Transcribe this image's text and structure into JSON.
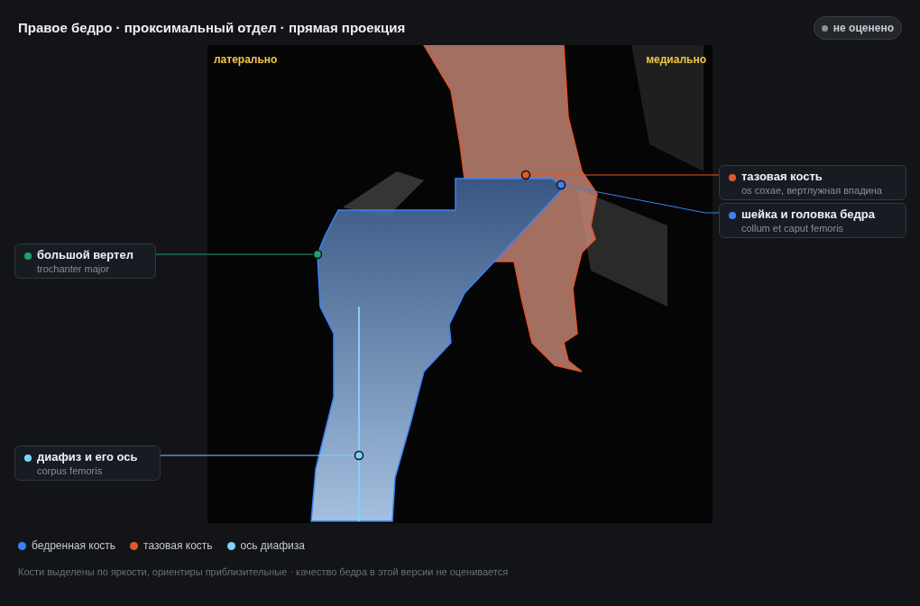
{
  "title": "Правое бедро · проксимальный отдел · прямая проекция",
  "status_badge": {
    "label": "не оценено",
    "kind": "not_rated"
  },
  "image": {
    "left_label": "латерально",
    "right_label": "медиально"
  },
  "landmarks": [
    {
      "kind": "pelvis",
      "name": "тазовая кость",
      "latin": "os coxae, вертлужная впадина",
      "color": "#e2572b"
    },
    {
      "kind": "femoral_head",
      "name": "шейка и головка бедра",
      "latin": "collum et caput femoris",
      "color": "#3b82f6"
    },
    {
      "kind": "trochanter",
      "name": "большой вертел",
      "latin": "trochanter major",
      "color": "#1fa36b"
    },
    {
      "kind": "shaft",
      "name": "диафиз и его ось",
      "latin": "corpus femoris",
      "color": "#7dd3fc"
    }
  ],
  "legend": [
    {
      "label": "бедренная кость",
      "color": "#3b82f6"
    },
    {
      "label": "тазовая кость",
      "color": "#e2572b"
    },
    {
      "label": "ось диафиза",
      "color": "#7dd3fc"
    }
  ],
  "footnote": "Кости выделены по яркости, ориентиры приблизительные · качество бедра в этой версии не оценивается"
}
